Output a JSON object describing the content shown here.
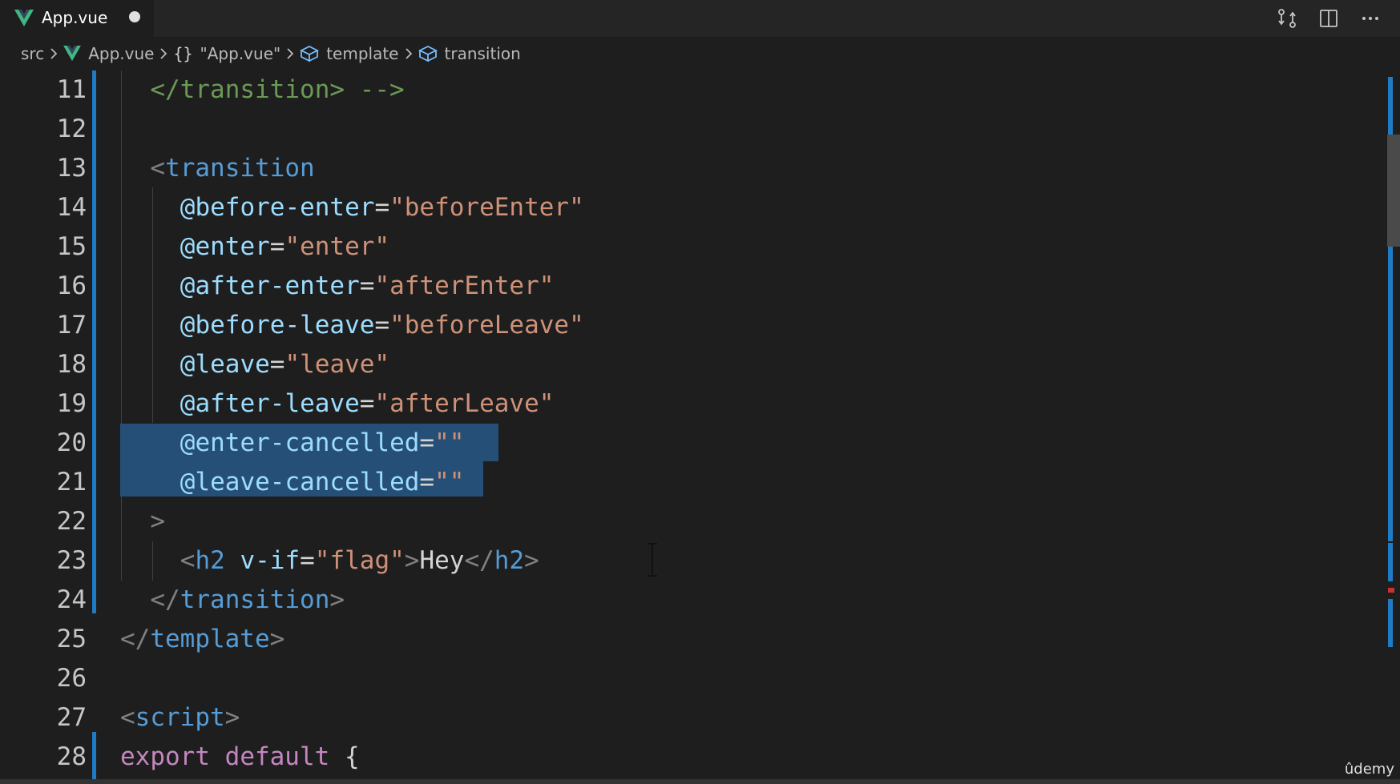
{
  "tab": {
    "title": "App.vue",
    "icon": "vue-logo-icon",
    "dirty": true,
    "logo_color": "#41b883"
  },
  "actions": [
    {
      "name": "open-changes-icon"
    },
    {
      "name": "split-editor-icon"
    },
    {
      "name": "more-actions-icon"
    }
  ],
  "breadcrumb": {
    "items": [
      {
        "label": "src",
        "icon": ""
      },
      {
        "label": "App.vue",
        "icon": "vue-logo-icon"
      },
      {
        "label": "\"App.vue\"",
        "icon": "braces-icon"
      },
      {
        "label": "template",
        "icon": "cube-icon"
      },
      {
        "label": "transition",
        "icon": "cube-icon"
      }
    ]
  },
  "editor": {
    "lines": [
      {
        "n": "11",
        "tokens": [
          {
            "t": "</transition> -->",
            "c": "comment"
          }
        ]
      },
      {
        "n": "12",
        "tokens": []
      },
      {
        "n": "13",
        "tokens": [
          {
            "t": "<",
            "c": "punct"
          },
          {
            "t": "transition",
            "c": "tag"
          }
        ]
      },
      {
        "n": "14",
        "tokens": [
          {
            "t": "@before-enter",
            "c": "attr"
          },
          {
            "t": "=",
            "c": "text"
          },
          {
            "t": "\"beforeEnter\"",
            "c": "str"
          }
        ]
      },
      {
        "n": "15",
        "tokens": [
          {
            "t": "@enter",
            "c": "attr"
          },
          {
            "t": "=",
            "c": "text"
          },
          {
            "t": "\"enter\"",
            "c": "str"
          }
        ]
      },
      {
        "n": "16",
        "tokens": [
          {
            "t": "@after-enter",
            "c": "attr"
          },
          {
            "t": "=",
            "c": "text"
          },
          {
            "t": "\"afterEnter\"",
            "c": "str"
          }
        ]
      },
      {
        "n": "17",
        "tokens": [
          {
            "t": "@before-leave",
            "c": "attr"
          },
          {
            "t": "=",
            "c": "text"
          },
          {
            "t": "\"beforeLeave\"",
            "c": "str"
          }
        ]
      },
      {
        "n": "18",
        "tokens": [
          {
            "t": "@leave",
            "c": "attr"
          },
          {
            "t": "=",
            "c": "text"
          },
          {
            "t": "\"leave\"",
            "c": "str"
          }
        ]
      },
      {
        "n": "19",
        "tokens": [
          {
            "t": "@after-leave",
            "c": "attr"
          },
          {
            "t": "=",
            "c": "text"
          },
          {
            "t": "\"afterLeave\"",
            "c": "str"
          }
        ]
      },
      {
        "n": "20",
        "tokens": [
          {
            "t": "@enter-cancelled",
            "c": "attr"
          },
          {
            "t": "=",
            "c": "text"
          },
          {
            "t": "\"\"",
            "c": "str"
          }
        ]
      },
      {
        "n": "21",
        "tokens": [
          {
            "t": "@leave-cancelled",
            "c": "attr"
          },
          {
            "t": "=",
            "c": "text"
          },
          {
            "t": "\"\"",
            "c": "str"
          }
        ]
      },
      {
        "n": "22",
        "tokens": [
          {
            "t": ">",
            "c": "punct"
          }
        ]
      },
      {
        "n": "23",
        "tokens": [
          {
            "t": "<",
            "c": "punct"
          },
          {
            "t": "h2",
            "c": "tag"
          },
          {
            "t": " ",
            "c": "text"
          },
          {
            "t": "v-if",
            "c": "attr"
          },
          {
            "t": "=",
            "c": "text"
          },
          {
            "t": "\"flag\"",
            "c": "str"
          },
          {
            "t": ">",
            "c": "punct"
          },
          {
            "t": "Hey",
            "c": "text"
          },
          {
            "t": "</",
            "c": "punct"
          },
          {
            "t": "h2",
            "c": "tag"
          },
          {
            "t": ">",
            "c": "punct"
          }
        ]
      },
      {
        "n": "24",
        "tokens": [
          {
            "t": "</",
            "c": "punct"
          },
          {
            "t": "transition",
            "c": "tag"
          },
          {
            "t": ">",
            "c": "punct"
          }
        ]
      },
      {
        "n": "25",
        "tokens": [
          {
            "t": "</",
            "c": "punct"
          },
          {
            "t": "template",
            "c": "tag"
          },
          {
            "t": ">",
            "c": "punct"
          }
        ]
      },
      {
        "n": "26",
        "tokens": []
      },
      {
        "n": "27",
        "tokens": [
          {
            "t": "<",
            "c": "punct"
          },
          {
            "t": "script",
            "c": "tag"
          },
          {
            "t": ">",
            "c": "punct"
          }
        ]
      },
      {
        "n": "28",
        "tokens": [
          {
            "t": "export",
            "c": "kw"
          },
          {
            "t": " ",
            "c": "text"
          },
          {
            "t": "default",
            "c": "kw"
          },
          {
            "t": " {",
            "c": "text"
          }
        ]
      }
    ]
  },
  "watermark": "ûdemy"
}
